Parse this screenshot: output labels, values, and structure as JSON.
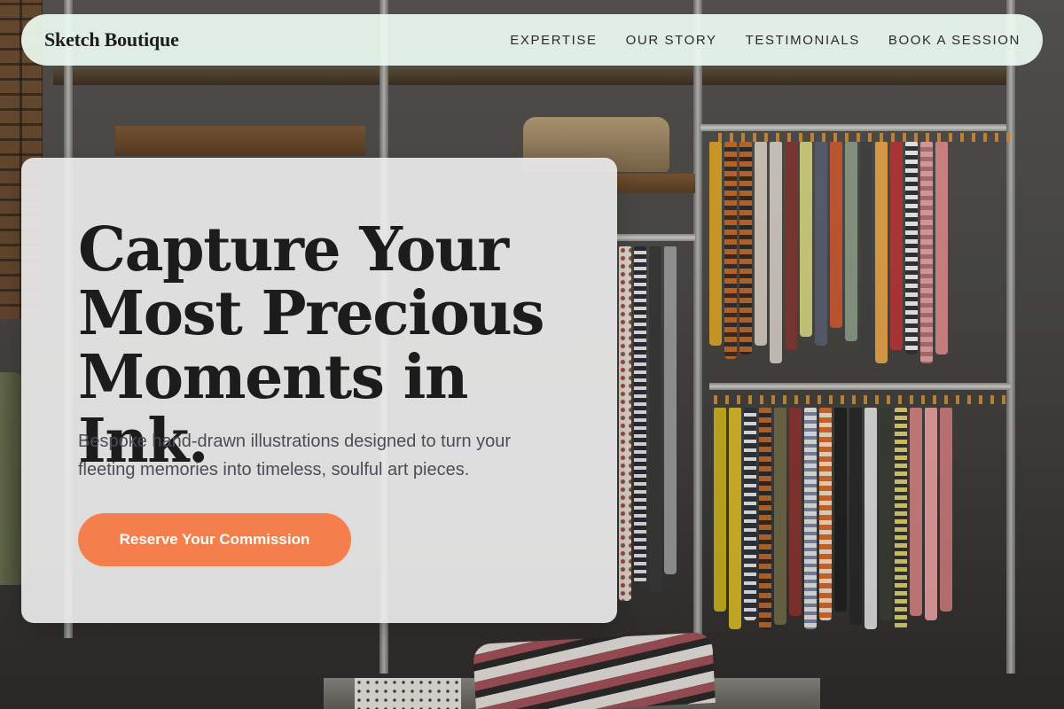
{
  "header": {
    "brand": "Sketch Boutique",
    "nav": [
      {
        "label": "EXPERTISE"
      },
      {
        "label": "OUR STORY"
      },
      {
        "label": "TESTIMONIALS"
      },
      {
        "label": "BOOK A SESSION"
      }
    ]
  },
  "hero": {
    "title_lines": [
      "Capture Your",
      "Most Precious",
      "Moments in Ink."
    ],
    "subtitle_lines": [
      "Bespoke hand-drawn illustrations designed to turn your",
      "fleeting memories into timeless, soulful art pieces."
    ],
    "cta_label": "Reserve Your Commission"
  },
  "colors": {
    "accent": "#f57f4c",
    "header_bg": "#ecfaf0",
    "card_bg": "#ececec",
    "title": "#1c1c1c",
    "subtitle": "#4a4e57"
  }
}
